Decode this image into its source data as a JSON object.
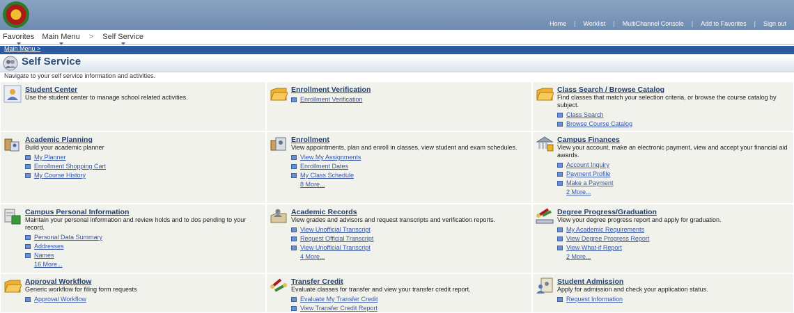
{
  "header": {
    "links": [
      "Home",
      "Worklist",
      "MultiChannel Console",
      "Add to Favorites",
      "Sign out"
    ]
  },
  "nav": {
    "favorites": "Favorites",
    "main_menu": "Main Menu",
    "sep": ">",
    "self_service": "Self Service"
  },
  "breadcrumb": "Main Menu >",
  "page": {
    "title": "Self Service",
    "description": "Navigate to your self service information and activities."
  },
  "tiles": {
    "student_center": {
      "title": "Student Center",
      "desc": "Use the student center to manage school related activities."
    },
    "enrollment_verification": {
      "title": "Enrollment Verification",
      "links": [
        "Enrollment Verification"
      ]
    },
    "class_search": {
      "title": "Class Search / Browse Catalog",
      "desc": "Find classes that match your selection criteria, or browse the course catalog by subject.",
      "links": [
        "Class Search",
        "Browse Course Catalog"
      ]
    },
    "academic_planning": {
      "title": "Academic Planning",
      "desc": "Build your academic planner",
      "links": [
        "My Planner",
        "Enrollment Shopping Cart",
        "My Course History"
      ]
    },
    "enrollment": {
      "title": "Enrollment",
      "desc": "View appointments, plan and enroll in classes, view student and exam schedules.",
      "links": [
        "View My Assignments",
        "Enrollment Dates",
        "My Class Schedule"
      ],
      "more": "8 More..."
    },
    "campus_finances": {
      "title": "Campus Finances",
      "desc": "View your account, make an electronic payment, view and accept your financial aid awards.",
      "links": [
        "Account Inquiry",
        "Payment Profile",
        "Make a Payment"
      ],
      "more": "2 More..."
    },
    "campus_personal": {
      "title": "Campus Personal Information",
      "desc": "Maintain your personal information and review holds and to dos pending to your record.",
      "links": [
        "Personal Data Summary",
        "Addresses",
        "Names"
      ],
      "more": "16 More..."
    },
    "academic_records": {
      "title": "Academic Records",
      "desc": "View grades and advisors and request transcripts and verification reports.",
      "links": [
        "View Unofficial Transcript",
        "Request Official Transcript",
        "View Unofficial Transcript"
      ],
      "more": "4 More..."
    },
    "degree_progress": {
      "title": "Degree Progress/Graduation",
      "desc": "View your degree progress report and apply for graduation.",
      "links": [
        "My Academic Requirements",
        "View Degree Progress Report",
        "View What-if Report"
      ],
      "more": "2 More..."
    },
    "approval_workflow": {
      "title": "Approval Workflow",
      "desc": "Generic workflow for filing form requests",
      "links": [
        "Approval Workflow"
      ]
    },
    "transfer_credit": {
      "title": "Transfer Credit",
      "desc": "Evaluate classes for transfer and view your transfer credit report.",
      "links": [
        "Evaluate My Transfer Credit",
        "View Transfer Credit Report"
      ]
    },
    "student_admission": {
      "title": "Student Admission",
      "desc": "Apply for admission and check your application status.",
      "links": [
        "Request Information"
      ]
    }
  },
  "colors": {
    "title_blue": "#1d3f75",
    "link_blue": "#3756a6",
    "crumb_bar": "#2c5aa0",
    "tile_bg": "#f2f2ec"
  }
}
